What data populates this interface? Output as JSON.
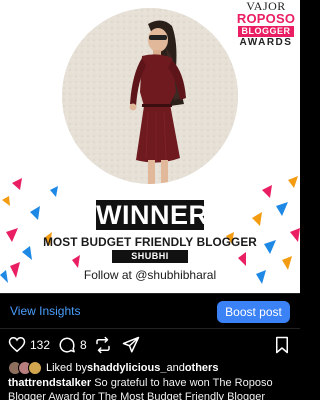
{
  "post": {
    "logo": {
      "line1": "VAJOR",
      "line2": "ROPOSO",
      "line3": "BLOGGER",
      "line4": "AWARDS"
    },
    "winner": "WINNER",
    "headline": "MOST BUDGET FRIENDLY BLOGGER",
    "name": "SHUBHI BHARAL",
    "follow": "Follow at @shubhibharal"
  },
  "insights": {
    "view_label": "View Insights",
    "boost_label": "Boost post"
  },
  "actions": {
    "like_icon": "heart-icon",
    "like_count": "132",
    "comment_icon": "comment-icon",
    "comment_count": "8",
    "repost_icon": "repost-icon",
    "share_icon": "share-icon",
    "save_icon": "bookmark-icon"
  },
  "likes": {
    "prefix": "Liked by ",
    "user": "shaddylicious_",
    "middle": " and ",
    "others": "others"
  },
  "caption": {
    "username": "thattrendstalker",
    "line1": "So grateful to have won The Roposo",
    "line2": "Blogger Award for The Most Budget Friendly Blogger"
  },
  "colors": {
    "accent_pink": "#e91e63",
    "dress": "#6e1a1f",
    "link_blue": "#4a9eff",
    "button_blue": "#3b82f6"
  }
}
